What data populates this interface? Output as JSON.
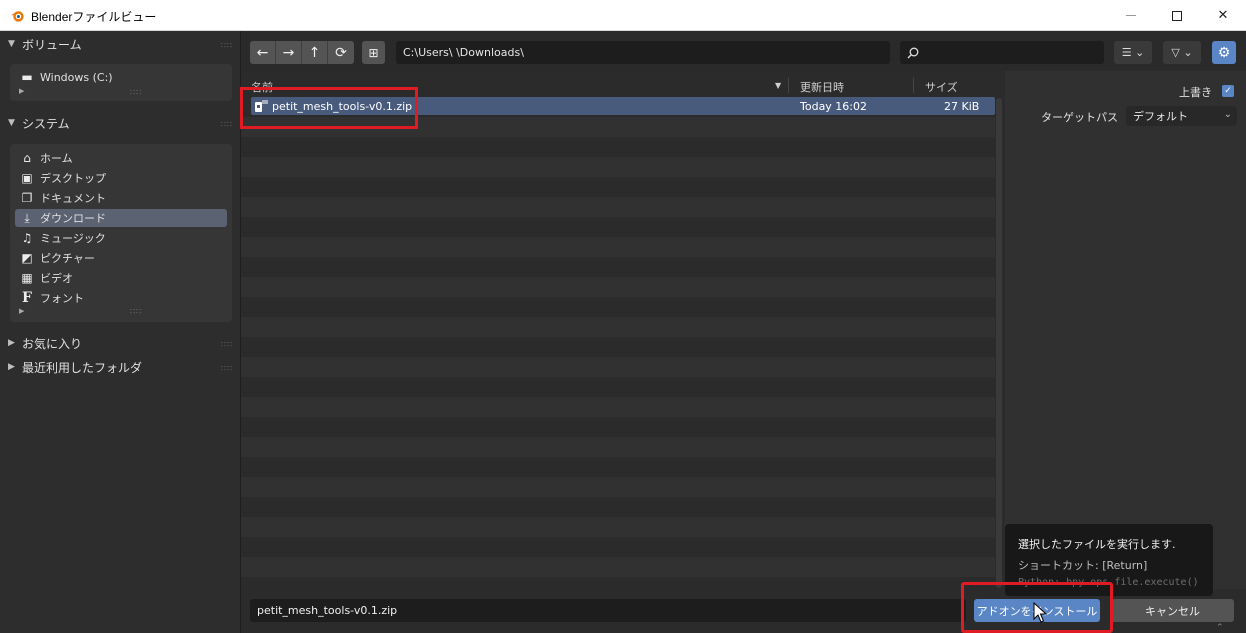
{
  "window": {
    "title": "Blenderファイルビュー",
    "controls": {
      "minimize": "minimize",
      "maximize": "maximize",
      "close": "✕"
    }
  },
  "sidebar": {
    "volumes": {
      "header": "ボリューム",
      "items": [
        {
          "label": "Windows (C:)",
          "icon": "drive-icon"
        }
      ]
    },
    "system": {
      "header": "システム",
      "items": [
        {
          "label": "ホーム",
          "icon": "home-icon",
          "active": false
        },
        {
          "label": "デスクトップ",
          "icon": "desktop-icon",
          "active": false
        },
        {
          "label": "ドキュメント",
          "icon": "documents-icon",
          "active": false
        },
        {
          "label": "ダウンロード",
          "icon": "download-icon",
          "active": true
        },
        {
          "label": "ミュージック",
          "icon": "music-icon",
          "active": false
        },
        {
          "label": "ピクチャー",
          "icon": "pictures-icon",
          "active": false
        },
        {
          "label": "ビデオ",
          "icon": "video-icon",
          "active": false
        },
        {
          "label": "フォント",
          "icon": "font-icon",
          "active": false
        }
      ]
    },
    "favorites": {
      "header": "お気に入り"
    },
    "recent": {
      "header": "最近利用したフォルダ"
    }
  },
  "toolbar": {
    "path": "C:\\Users\\          \\Downloads\\",
    "search_value": "",
    "nav_icons": [
      "back-arrow-icon",
      "forward-arrow-icon",
      "parent-dir-icon",
      "refresh-icon"
    ]
  },
  "filelist": {
    "columns": {
      "name": "名前",
      "modified": "更新日時",
      "size": "サイズ"
    },
    "files": [
      {
        "name": "petit_mesh_tools-v0.1.zip",
        "modified": "Today 16:02",
        "size": "27 KiB",
        "selected": true
      }
    ]
  },
  "options": {
    "overwrite_label": "上書き",
    "overwrite_checked": true,
    "target_path_label": "ターゲットパス",
    "target_path_value": "デフォルト"
  },
  "bottom": {
    "filename": "petit_mesh_tools-v0.1.zip",
    "install_label": "アドオンをインストール",
    "cancel_label": "キャンセル"
  },
  "tooltip": {
    "description": "選択したファイルを実行します.",
    "shortcut": "ショートカット: [Return]",
    "python": "Python: bpy.ops.file.execute()"
  },
  "colors": {
    "accent": "#5a86c6",
    "selection": "#495b7c",
    "highlight": "#e01b24"
  }
}
